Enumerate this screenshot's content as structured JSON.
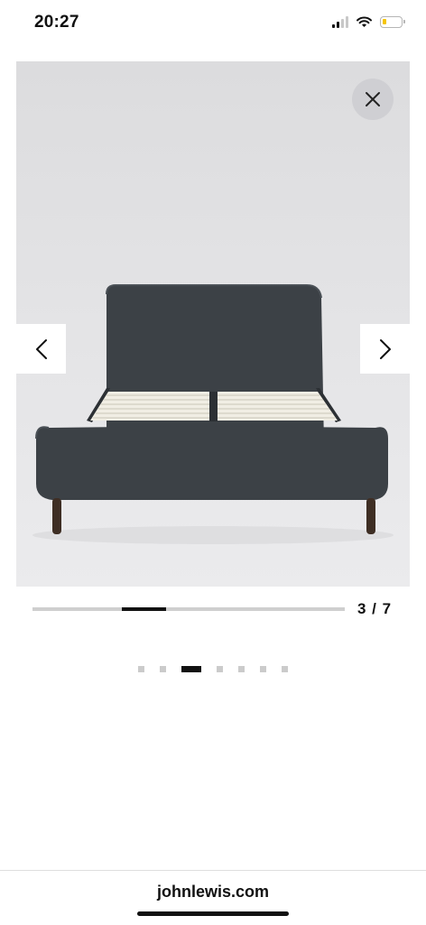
{
  "status": {
    "time": "20:27",
    "signal_bars": 2,
    "battery_level": 0.2
  },
  "gallery": {
    "current": 3,
    "total": 7,
    "counter_text": "3 / 7"
  },
  "icons": {
    "close": "close-icon",
    "prev": "chevron-left-icon",
    "next": "chevron-right-icon"
  },
  "colors": {
    "bed_fabric": "#3c4146",
    "legs": "#3e2e24",
    "slats": "#f1eee4",
    "accent": "#111111"
  },
  "browser": {
    "url": "johnlewis.com"
  }
}
